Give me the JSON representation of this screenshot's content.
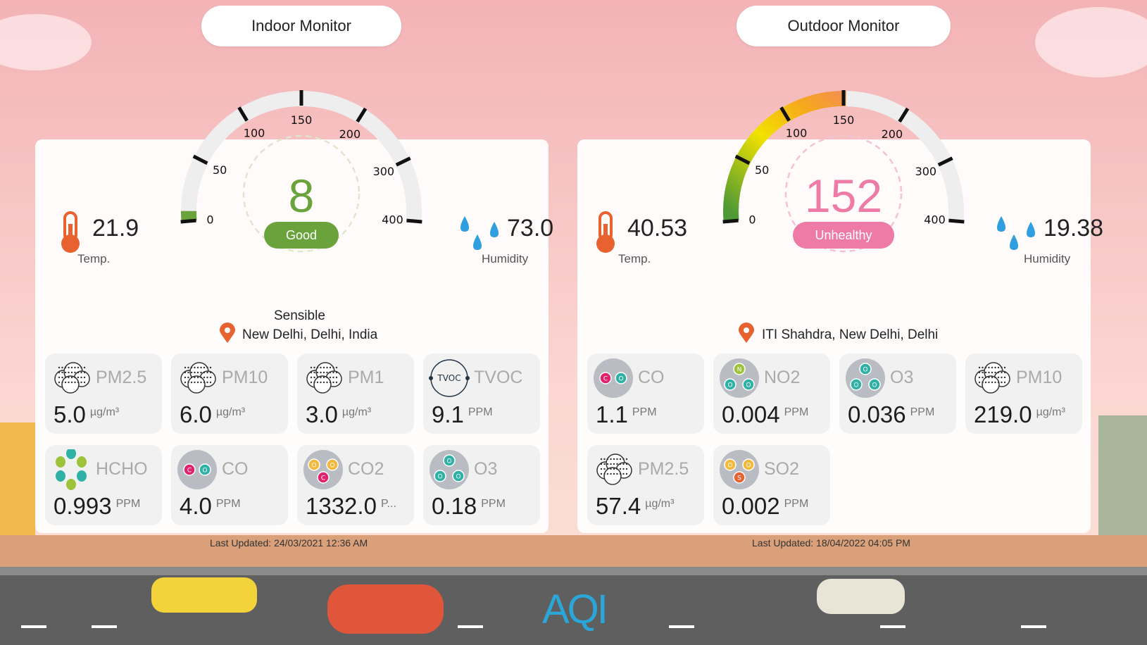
{
  "indoor": {
    "title": "Indoor Monitor",
    "aqi": {
      "value": 8,
      "status": "Good",
      "color": "#6aa33c"
    },
    "gauge_ticks": [
      "0",
      "50",
      "100",
      "150",
      "200",
      "300",
      "400"
    ],
    "temperature": {
      "value": "21.9",
      "label": "Temp."
    },
    "humidity": {
      "value": "73.0",
      "label": "Humidity"
    },
    "location_name": "Sensible",
    "location": "New Delhi, Delhi, India",
    "tiles": [
      {
        "name": "PM2.5",
        "value": "5.0",
        "unit": "µg/m³",
        "icon": "dust-cloud-icon"
      },
      {
        "name": "PM10",
        "value": "6.0",
        "unit": "µg/m³",
        "icon": "dust-cloud-icon"
      },
      {
        "name": "PM1",
        "value": "3.0",
        "unit": "µg/m³",
        "icon": "dust-cloud-icon"
      },
      {
        "name": "TVOC",
        "value": "9.1",
        "unit": "PPM",
        "icon": "tvoc-icon"
      },
      {
        "name": "HCHO",
        "value": "0.993",
        "unit": "PPM",
        "icon": "hcho-molecule-icon"
      },
      {
        "name": "CO",
        "value": "4.0",
        "unit": "PPM",
        "icon": "co-molecule-icon"
      },
      {
        "name": "CO2",
        "value": "1332.0",
        "unit": "P...",
        "icon": "co2-molecule-icon"
      },
      {
        "name": "O3",
        "value": "0.18",
        "unit": "PPM",
        "icon": "o3-molecule-icon"
      }
    ],
    "last_updated": "Last Updated: 24/03/2021 12:36 AM"
  },
  "outdoor": {
    "title": "Outdoor Monitor",
    "aqi": {
      "value": 152,
      "status": "Unhealthy",
      "color": "#ee7aa6"
    },
    "gauge_ticks": [
      "0",
      "50",
      "100",
      "150",
      "200",
      "300",
      "400"
    ],
    "temperature": {
      "value": "40.53",
      "label": "Temp."
    },
    "humidity": {
      "value": "19.38",
      "label": "Humidity"
    },
    "location": "ITI Shahdra, New Delhi, Delhi",
    "tiles": [
      {
        "name": "CO",
        "value": "1.1",
        "unit": "PPM",
        "icon": "co-molecule-icon"
      },
      {
        "name": "NO2",
        "value": "0.004",
        "unit": "PPM",
        "icon": "no2-molecule-icon"
      },
      {
        "name": "O3",
        "value": "0.036",
        "unit": "PPM",
        "icon": "o3-molecule-icon"
      },
      {
        "name": "PM10",
        "value": "219.0",
        "unit": "µg/m³",
        "icon": "dust-cloud-icon"
      },
      {
        "name": "PM2.5",
        "value": "57.4",
        "unit": "µg/m³",
        "icon": "dust-cloud-icon"
      },
      {
        "name": "SO2",
        "value": "0.002",
        "unit": "PPM",
        "icon": "so2-molecule-icon"
      }
    ],
    "last_updated": "Last Updated: 18/04/2022 04:05 PM"
  },
  "brand": "AQI",
  "colors": {
    "temp_icon": "#e8622f",
    "drop": "#2f9fe0",
    "pin": "#e8622f",
    "sky": "#f6c9c9",
    "road": "#6b6b6b"
  }
}
